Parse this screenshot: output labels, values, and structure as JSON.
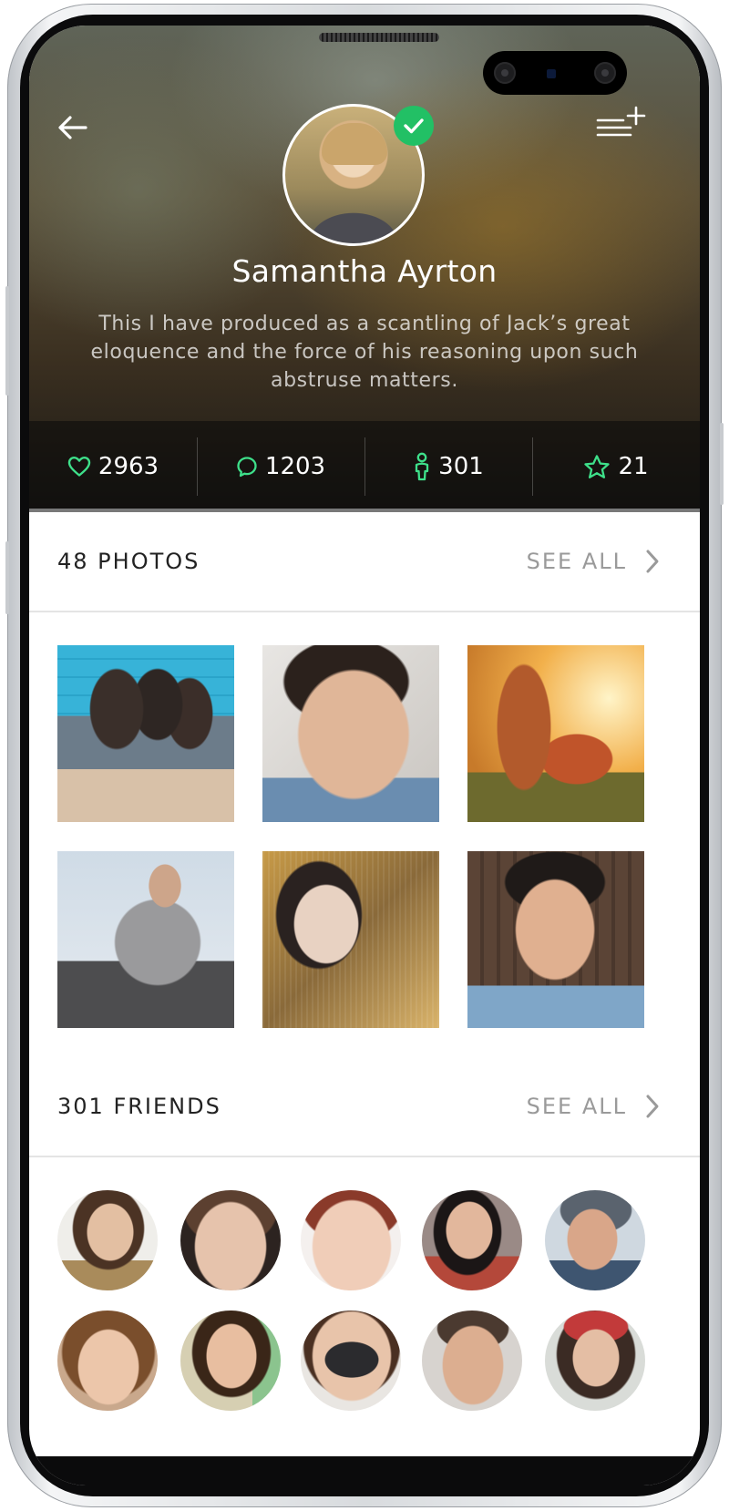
{
  "profile": {
    "name": "Samantha Ayrton",
    "bio": "This I have produced as a scantling of Jack’s great eloquence and the force of his reasoning upon such abstruse matters."
  },
  "stats": {
    "likes": "2963",
    "comments": "1203",
    "followers": "301",
    "favorites": "21"
  },
  "photos_section": {
    "title": "48 PHOTOS",
    "see_all": "SEE ALL"
  },
  "friends_section": {
    "title": "301 FRIENDS",
    "see_all": "SEE ALL"
  },
  "colors": {
    "accent": "#22c065",
    "stat_icon": "#3ee08a"
  },
  "icons": [
    "back-arrow-icon",
    "menu-add-icon",
    "check-icon",
    "heart-icon",
    "chat-bubble-icon",
    "person-icon",
    "star-icon",
    "chevron-right-icon"
  ]
}
